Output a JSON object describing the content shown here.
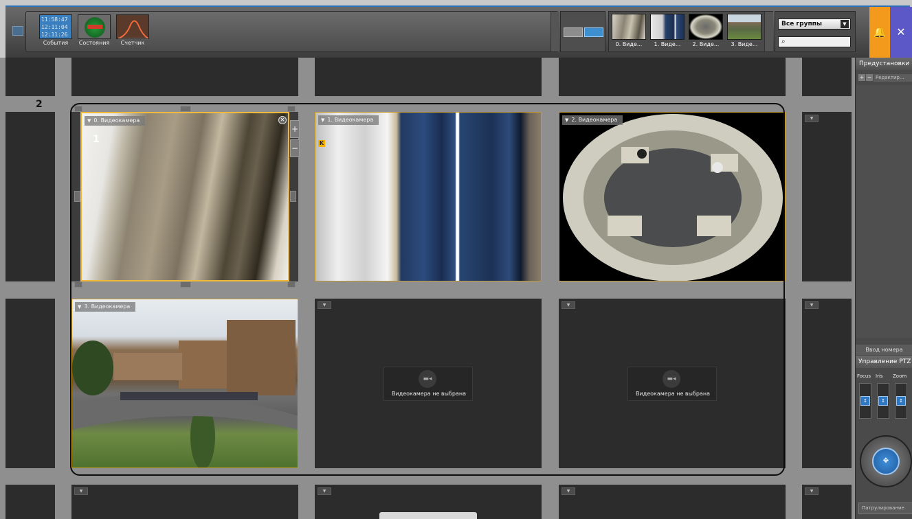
{
  "toolbar": {
    "events_label": "События",
    "events_times": [
      "11:58:47",
      "12:11:04",
      "12:11:26"
    ],
    "states_label": "Состояния",
    "counter_label": "Счетчик",
    "cameras": [
      {
        "label": "0. Виде..."
      },
      {
        "label": "1. Виде..."
      },
      {
        "label": "2. Виде..."
      },
      {
        "label": "3. Виде..."
      }
    ],
    "group_select": "Все группы",
    "search_icon": "search-icon"
  },
  "grid": {
    "cam0_title": "0. Видеокамера",
    "cam1_title": "1. Видеокамера",
    "cam2_title": "2. Видеокамера",
    "cam3_title": "3. Видеокамера",
    "empty_text": "Видеокамера не выбрана",
    "marker_1": "1",
    "marker_2": "2"
  },
  "right_panel": {
    "presets_title": "Предустановки",
    "edit_label": "Редактир...",
    "number_input": "Ввод номера",
    "ptz_title": "Управление PTZ",
    "sliders": [
      "Focus",
      "Iris",
      "Zoom"
    ],
    "patrol_label": "Патрулирование"
  },
  "colors": {
    "accent_blue": "#2b6fb5",
    "selection": "#f0b93a",
    "alert": "#f39a1c",
    "tools": "#5c58c8"
  }
}
